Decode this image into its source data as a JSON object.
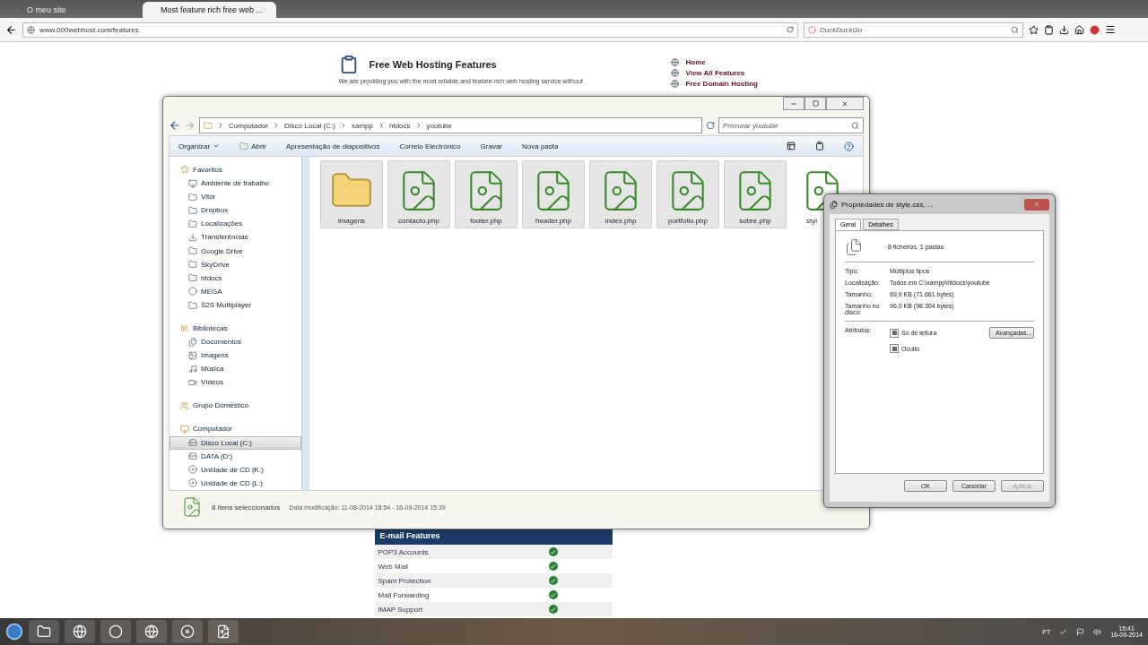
{
  "browser": {
    "tabs": [
      {
        "label": "O meu site",
        "selected": false
      },
      {
        "label": "Most feature rich free web ...",
        "selected": true
      }
    ],
    "url": "www.000webhost.com/features",
    "search": {
      "placeholder": "DuckDuckGo"
    }
  },
  "webpage": {
    "heading": "Free Web Hosting Features",
    "intro": "We are providing you with the most reliable and feature-rich web hosting service without",
    "links": [
      "Home",
      "View All Features",
      "Free Domain Hosting"
    ],
    "email_table": {
      "title": "E-mail Features",
      "rows": [
        {
          "feature": "POP3 Accounts",
          "supported": true
        },
        {
          "feature": "Web Mail",
          "supported": true
        },
        {
          "feature": "Spam Protection",
          "supported": true
        },
        {
          "feature": "Mail Forwarding",
          "supported": true
        },
        {
          "feature": "IMAP Support",
          "supported": true
        }
      ]
    }
  },
  "explorer": {
    "breadcrumb": [
      "Computador",
      "Disco Local (C:)",
      "xampp",
      "htdocs",
      "youtube"
    ],
    "search": {
      "placeholder": "Procurar youtube"
    },
    "toolbar": [
      "Organizar",
      "Abrir",
      "Apresentação de diapositivos",
      "Correio Electrónico",
      "Gravar",
      "Nova pasta"
    ],
    "nav_tree": [
      {
        "label": "Favoritos",
        "children": [
          {
            "label": "Ambiente de trabalho",
            "selected": false
          },
          {
            "label": "Vitor",
            "selected": false
          },
          {
            "label": "Dropbox",
            "selected": false
          },
          {
            "label": "Localizações",
            "selected": false
          },
          {
            "label": "Transferências",
            "selected": false
          },
          {
            "label": "Google Drive",
            "selected": false
          },
          {
            "label": "SkyDrive",
            "selected": false
          },
          {
            "label": "htdocs",
            "selected": false
          },
          {
            "label": "MEGA",
            "selected": false
          },
          {
            "label": "S2S Multiplayer",
            "selected": false
          }
        ]
      },
      {
        "label": "Bibliotecas",
        "children": [
          {
            "label": "Documentos",
            "selected": false
          },
          {
            "label": "Imagens",
            "selected": false
          },
          {
            "label": "Música",
            "selected": false
          },
          {
            "label": "Vídeos",
            "selected": false
          }
        ]
      },
      {
        "label": "Grupo Doméstico"
      },
      {
        "label": "Computador",
        "children": [
          {
            "label": "Disco Local (C:)",
            "selected": true
          },
          {
            "label": "DATA (D:)",
            "selected": false
          },
          {
            "label": "Unidade de CD (K:)",
            "selected": false
          },
          {
            "label": "Unidade de CD (L:)",
            "selected": false
          }
        ]
      }
    ],
    "files": [
      {
        "name": "imagens",
        "kind": "folder",
        "selected": true
      },
      {
        "name": "contacto.php",
        "kind": "file",
        "selected": true
      },
      {
        "name": "footer.php",
        "kind": "file",
        "selected": true
      },
      {
        "name": "header.php",
        "kind": "file",
        "selected": true
      },
      {
        "name": "index.php",
        "kind": "file",
        "selected": true
      },
      {
        "name": "portfolio.php",
        "kind": "file",
        "selected": true
      },
      {
        "name": "sobre.php",
        "kind": "file",
        "selected": true
      },
      {
        "name": "styl",
        "kind": "file",
        "selected": false
      }
    ],
    "status": {
      "count": "8 itens seleccionados",
      "modified": "Data modificação: 11-08-2014 18:54 - 16-09-2014 15:39"
    }
  },
  "properties": {
    "title": "Propriedades de style.css, ...",
    "tabs": [
      {
        "label": "Geral",
        "selected": true
      },
      {
        "label": "Detalhes",
        "selected": false
      }
    ],
    "summary": "8 ficheiros, 1 pastas",
    "rows": [
      {
        "label": "Tipo:",
        "value": "Múltiplos tipos"
      },
      {
        "label": "Localização:",
        "value": "Todos em C:\\xampp\\htdocs\\youtube"
      },
      {
        "label": "Tamanho:",
        "value": "69,9 KB (71.661 bytes)"
      },
      {
        "label": "Tamanho no disco:",
        "value": "96,0 KB (98.304 bytes)"
      }
    ],
    "attributes_label": "Atributos:",
    "attributes": [
      {
        "label": "Só de leitura",
        "mixed": true
      },
      {
        "label": "Oculto",
        "mixed": true
      }
    ],
    "advanced": "Avançadas...",
    "buttons": [
      {
        "label": "OK",
        "disabled": false
      },
      {
        "label": "Cancelar",
        "disabled": false
      },
      {
        "label": "Aplicar",
        "disabled": true
      }
    ]
  },
  "taskbar": {
    "language": "PT",
    "time": "15:41",
    "date": "16-09-2014"
  }
}
